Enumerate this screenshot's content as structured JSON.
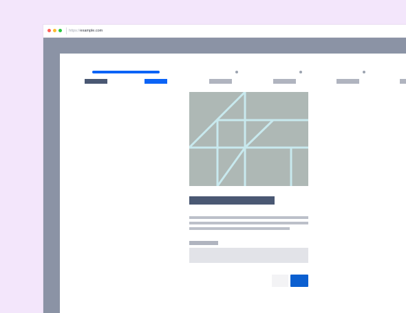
{
  "browser": {
    "url_protocol": "https://",
    "url_host": "example.com"
  },
  "wizard": {
    "progress": 0.2,
    "active_step": 1,
    "step_count": 5
  },
  "colors": {
    "page_background": "#f3e6fb",
    "browser_frame": "#8b93a5",
    "accent": "#0b63f6",
    "primary_button": "#0b5fd0",
    "heading_placeholder": "#4a5873",
    "text_placeholder": "#bcc0c9",
    "image_fill": "#aeb8b5",
    "image_lines": "#c8e9ee"
  },
  "icons": {
    "window_controls": [
      "close-dot-icon",
      "minimize-dot-icon",
      "maximize-dot-icon"
    ],
    "hero": "image-placeholder-icon"
  }
}
